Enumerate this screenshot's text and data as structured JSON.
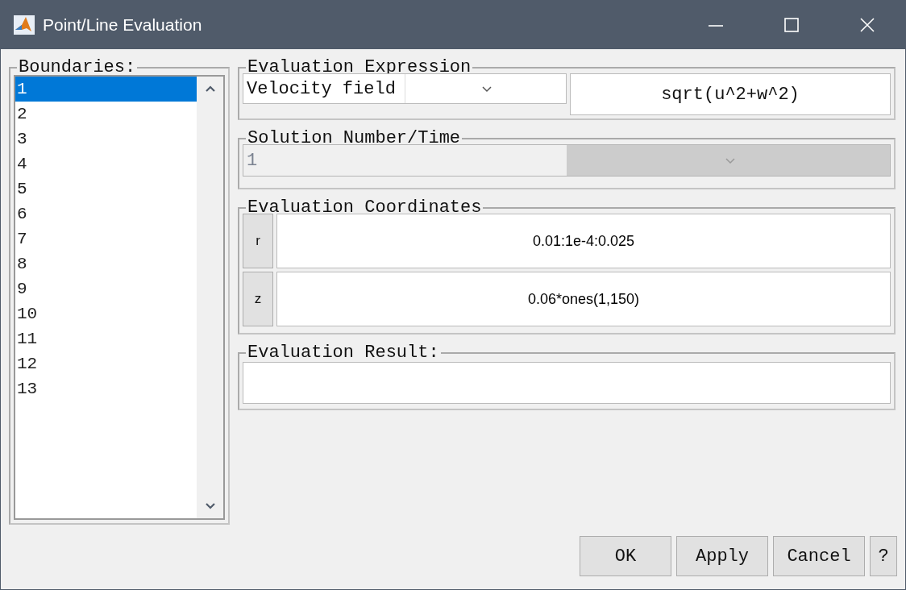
{
  "window": {
    "title": "Point/Line Evaluation"
  },
  "boundaries": {
    "label": "Boundaries:",
    "items": [
      {
        "label": "1",
        "selected": true
      },
      {
        "label": "2",
        "selected": false
      },
      {
        "label": "3",
        "selected": false
      },
      {
        "label": "4",
        "selected": false
      },
      {
        "label": "5",
        "selected": false
      },
      {
        "label": "6",
        "selected": false
      },
      {
        "label": "7",
        "selected": false
      },
      {
        "label": "8",
        "selected": false
      },
      {
        "label": "9",
        "selected": false
      },
      {
        "label": "10",
        "selected": false
      },
      {
        "label": "11",
        "selected": false
      },
      {
        "label": "12",
        "selected": false
      },
      {
        "label": "13",
        "selected": false
      }
    ]
  },
  "expression": {
    "label": "Evaluation Expression",
    "dropdown": "Velocity field",
    "value": "sqrt(u^2+w^2)"
  },
  "solution": {
    "label": "Solution Number/Time",
    "value": "1",
    "disabled": true
  },
  "coordinates": {
    "label": "Evaluation Coordinates",
    "rows": [
      {
        "name": "r",
        "value": "0.01:1e-4:0.025"
      },
      {
        "name": "z",
        "value": "0.06*ones(1,150)"
      }
    ]
  },
  "result": {
    "label": "Evaluation Result:"
  },
  "buttons": [
    "OK",
    "Apply",
    "Cancel",
    "?"
  ]
}
